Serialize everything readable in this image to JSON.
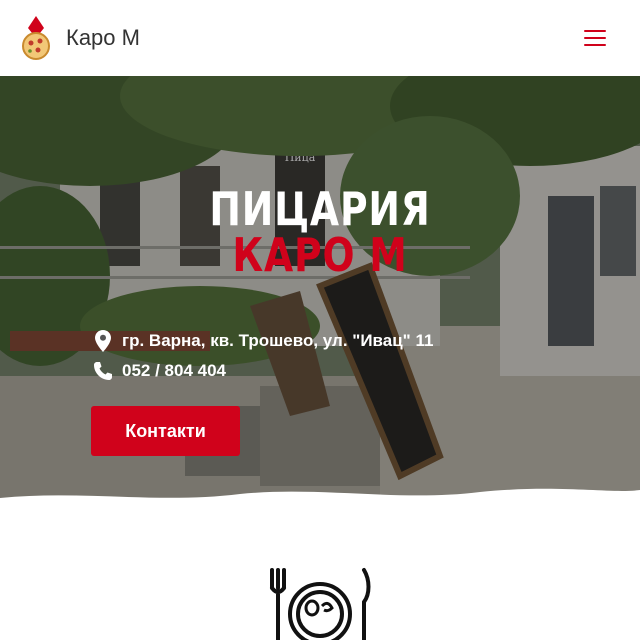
{
  "header": {
    "brand": "Каро М",
    "logo_icon": "pizza-diamond-logo-icon",
    "menu_icon": "hamburger-menu-icon",
    "accent_color": "#d0021b"
  },
  "hero": {
    "title_line1": "ПИЦАРИЯ",
    "title_line2": "КАРО М",
    "address": "гр. Варна, кв. Трошево, ул. \"Ивац\" 11",
    "phone": "052 / 804 404",
    "address_icon": "map-pin-icon",
    "phone_icon": "phone-icon",
    "cta_label": "Контакти",
    "background_photo": "pizzeria storefront with trees and chalkboard sign",
    "photo_sign_text": "Пица"
  },
  "section": {
    "icon": "plate-fork-knife-icon"
  }
}
